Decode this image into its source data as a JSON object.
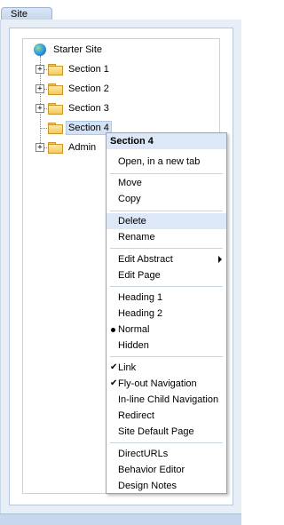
{
  "tab": {
    "label": "Site"
  },
  "tree": {
    "root": "Starter Site",
    "nodes": [
      {
        "label": "Section 1",
        "expandable": true
      },
      {
        "label": "Section 2",
        "expandable": true
      },
      {
        "label": "Section 3",
        "expandable": true
      },
      {
        "label": "Section 4",
        "expandable": false,
        "selected": true
      },
      {
        "label": "Admin",
        "expandable": true
      }
    ],
    "expander_glyph": "+"
  },
  "menu": {
    "title": "Section 4",
    "items": {
      "open_new_tab": "Open, in a new tab",
      "move": "Move",
      "copy": "Copy",
      "delete": "Delete",
      "rename": "Rename",
      "edit_abstract": "Edit Abstract",
      "edit_page": "Edit Page",
      "heading1": "Heading 1",
      "heading2": "Heading 2",
      "normal": "Normal",
      "hidden": "Hidden",
      "link": "Link",
      "flyout_nav": "Fly-out Navigation",
      "inline_child_nav": "In-line Child Navigation",
      "redirect": "Redirect",
      "site_default_page": "Site Default Page",
      "direct_urls": "DirectURLs",
      "behavior_editor": "Behavior Editor",
      "design_notes": "Design Notes"
    },
    "check_glyph": "✔",
    "highlighted": "Delete"
  }
}
